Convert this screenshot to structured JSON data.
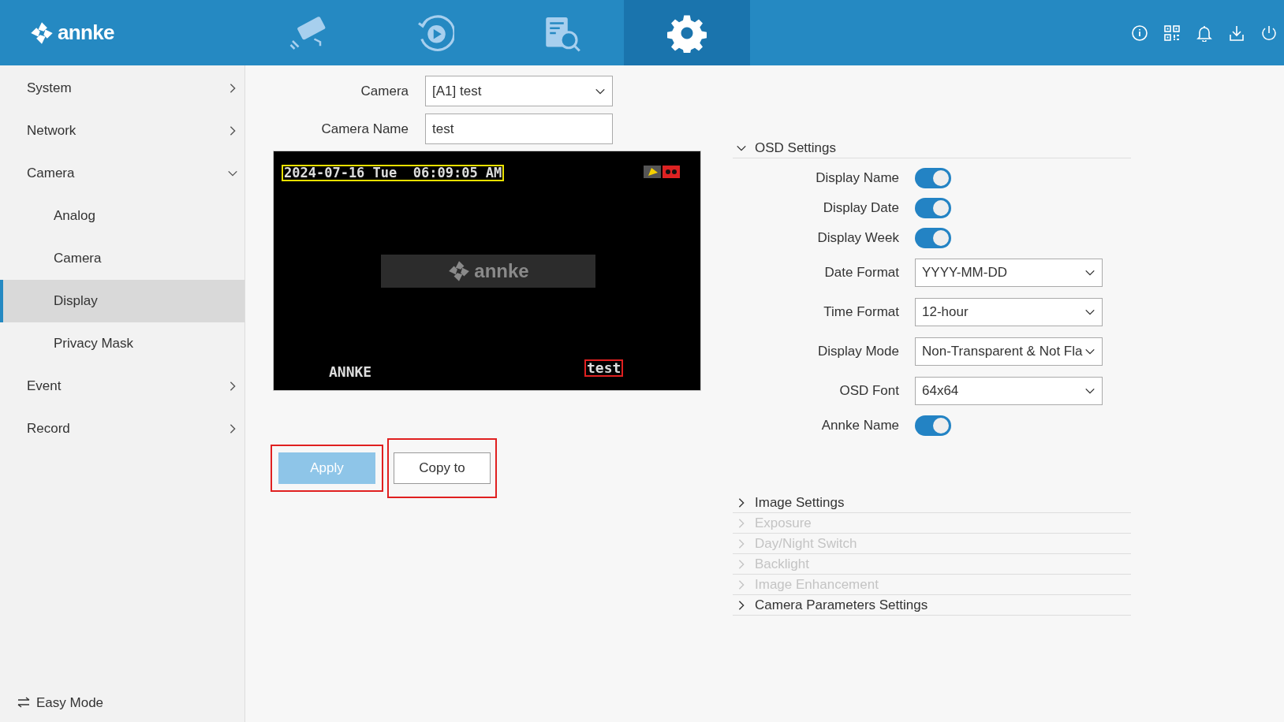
{
  "header": {
    "logo": "annke",
    "tabs": [
      {
        "kind": "live",
        "selected": false
      },
      {
        "kind": "playback",
        "selected": false
      },
      {
        "kind": "search",
        "selected": false
      },
      {
        "kind": "settings",
        "selected": true
      }
    ]
  },
  "sidebar": {
    "items": [
      {
        "label": "System",
        "expanded": false
      },
      {
        "label": "Network",
        "expanded": false
      },
      {
        "label": "Camera",
        "expanded": true,
        "children": [
          {
            "label": "Analog",
            "selected": false
          },
          {
            "label": "Camera",
            "selected": false
          },
          {
            "label": "Display",
            "selected": true
          },
          {
            "label": "Privacy Mask",
            "selected": false
          }
        ]
      },
      {
        "label": "Event",
        "expanded": false
      },
      {
        "label": "Record",
        "expanded": false
      }
    ],
    "footer": "Easy Mode"
  },
  "camera_form": [
    {
      "label": "Camera",
      "kind": "select",
      "value": "[A1] test"
    },
    {
      "label": "Camera Name",
      "kind": "text",
      "value": "test"
    }
  ],
  "preview": {
    "datetime": "2024-07-16 Tue  06:09:05 AM",
    "logo": "annke",
    "bottom_left": "ANNKE",
    "camera_name": "test"
  },
  "buttons": [
    {
      "label": "Apply",
      "disabled": true
    },
    {
      "label": "Copy to",
      "disabled": false
    }
  ],
  "osd": {
    "title": "OSD Settings",
    "expanded": true,
    "rows": [
      {
        "label": "Display Name",
        "kind": "toggle",
        "on": true
      },
      {
        "label": "Display Date",
        "kind": "toggle",
        "on": true
      },
      {
        "label": "Display Week",
        "kind": "toggle",
        "on": true
      },
      {
        "label": "Date Format",
        "kind": "select",
        "value": "YYYY-MM-DD"
      },
      {
        "label": "Time Format",
        "kind": "select",
        "value": "12-hour"
      },
      {
        "label": "Display Mode",
        "kind": "select",
        "value": "Non-Transparent & Not Fla"
      },
      {
        "label": "OSD Font",
        "kind": "select",
        "value": "64x64"
      },
      {
        "label": "Annke Name",
        "kind": "toggle",
        "on": true
      }
    ]
  },
  "sections": [
    {
      "label": "Image Settings",
      "disabled": false
    },
    {
      "label": "Exposure",
      "disabled": true
    },
    {
      "label": "Day/Night Switch",
      "disabled": true
    },
    {
      "label": "Backlight",
      "disabled": true
    },
    {
      "label": "Image Enhancement",
      "disabled": true
    },
    {
      "label": "Camera Parameters Settings",
      "disabled": false
    }
  ]
}
